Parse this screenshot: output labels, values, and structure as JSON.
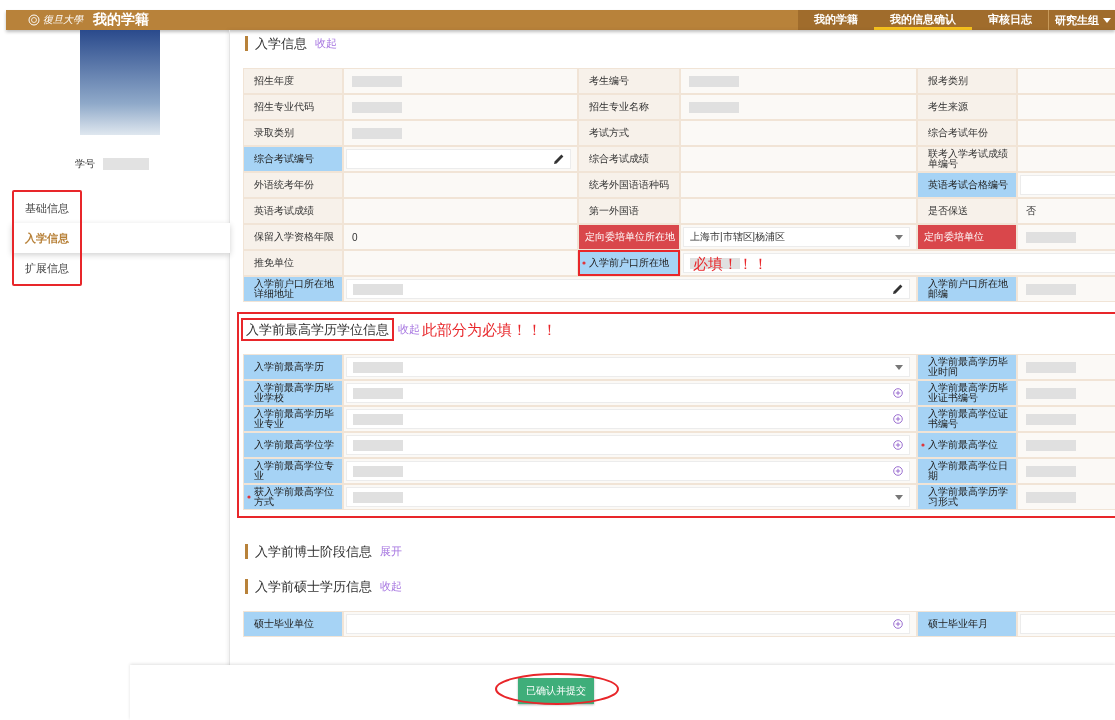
{
  "header": {
    "logo_text": "復旦大學",
    "title": "我的学籍",
    "nav": [
      {
        "label": "我的学籍",
        "selected": false
      },
      {
        "label": "我的信息确认",
        "selected": true
      },
      {
        "label": "审核日志",
        "selected": false
      }
    ],
    "user_menu": "研究生组"
  },
  "sidebar": {
    "student_id_label": "学号",
    "annotated": true,
    "items": [
      {
        "label": "基础信息",
        "selected": false
      },
      {
        "label": "入学信息",
        "selected": true
      },
      {
        "label": "扩展信息",
        "selected": false
      }
    ]
  },
  "sections": [
    {
      "title": "入学信息",
      "toggle": "收起",
      "annotated": false,
      "title_boxed": false,
      "rows": [
        {
          "fields": [
            {
              "label": "招生年度",
              "editable": false,
              "alert": false,
              "required": false,
              "annotated": false,
              "wide": false,
              "kind": "plain",
              "redacted": true
            },
            {
              "label": "考生编号",
              "editable": false,
              "alert": false,
              "required": false,
              "annotated": false,
              "wide": false,
              "kind": "plain",
              "redacted": true
            },
            {
              "label": "报考类别",
              "editable": false,
              "alert": false,
              "required": false,
              "annotated": false,
              "wide": false,
              "kind": "plain",
              "redacted": false
            }
          ]
        },
        {
          "fields": [
            {
              "label": "招生专业代码",
              "editable": false,
              "alert": false,
              "required": false,
              "annotated": false,
              "wide": false,
              "kind": "plain",
              "redacted": true
            },
            {
              "label": "招生专业名称",
              "editable": false,
              "alert": false,
              "required": false,
              "annotated": false,
              "wide": false,
              "kind": "plain",
              "redacted": true
            },
            {
              "label": "考生来源",
              "editable": false,
              "alert": false,
              "required": false,
              "annotated": false,
              "wide": false,
              "kind": "plain",
              "redacted": false
            }
          ]
        },
        {
          "fields": [
            {
              "label": "录取类别",
              "editable": false,
              "alert": false,
              "required": false,
              "annotated": false,
              "wide": false,
              "kind": "plain",
              "redacted": true
            },
            {
              "label": "考试方式",
              "editable": false,
              "alert": false,
              "required": false,
              "annotated": false,
              "wide": false,
              "kind": "plain",
              "redacted": false
            },
            {
              "label": "综合考试年份",
              "editable": false,
              "alert": false,
              "required": false,
              "annotated": false,
              "wide": false,
              "kind": "plain",
              "redacted": false
            }
          ]
        },
        {
          "fields": [
            {
              "label": "综合考试编号",
              "editable": true,
              "alert": false,
              "required": false,
              "annotated": false,
              "wide": false,
              "kind": "edit",
              "redacted": false
            },
            {
              "label": "综合考试成绩",
              "editable": false,
              "alert": false,
              "required": false,
              "annotated": false,
              "wide": false,
              "kind": "plain",
              "redacted": false
            },
            {
              "label": "联考入学考试成绩单编号",
              "editable": false,
              "alert": false,
              "required": false,
              "annotated": false,
              "wide": false,
              "kind": "plain",
              "redacted": false
            }
          ]
        },
        {
          "fields": [
            {
              "label": "外语统考年份",
              "editable": false,
              "alert": false,
              "required": false,
              "annotated": false,
              "wide": false,
              "kind": "plain",
              "redacted": false
            },
            {
              "label": "统考外国语语种码",
              "editable": false,
              "alert": false,
              "required": false,
              "annotated": false,
              "wide": false,
              "kind": "plain",
              "redacted": false
            },
            {
              "label": "英语考试合格编号",
              "editable": true,
              "alert": false,
              "required": false,
              "annotated": false,
              "wide": false,
              "kind": "input",
              "redacted": false
            }
          ]
        },
        {
          "fields": [
            {
              "label": "英语考试成绩",
              "editable": false,
              "alert": false,
              "required": false,
              "annotated": false,
              "wide": false,
              "kind": "plain",
              "redacted": false
            },
            {
              "label": "第一外国语",
              "editable": false,
              "alert": false,
              "required": false,
              "annotated": false,
              "wide": false,
              "kind": "plain",
              "redacted": false
            },
            {
              "label": "是否保送",
              "editable": false,
              "alert": false,
              "required": false,
              "annotated": false,
              "wide": false,
              "kind": "plain",
              "redacted": false,
              "value": "否"
            }
          ]
        },
        {
          "fields": [
            {
              "label": "保留入学资格年限",
              "editable": false,
              "alert": false,
              "required": false,
              "annotated": false,
              "wide": false,
              "kind": "plain",
              "redacted": false,
              "value": "0"
            },
            {
              "label": "定向委培单位所在地",
              "editable": false,
              "alert": true,
              "required": false,
              "annotated": false,
              "wide": false,
              "kind": "select",
              "redacted": false,
              "value": "上海市|市辖区|杨浦区"
            },
            {
              "label": "定向委培单位",
              "editable": false,
              "alert": true,
              "required": false,
              "annotated": false,
              "wide": false,
              "kind": "plain",
              "redacted": true
            }
          ]
        },
        {
          "fields": [
            {
              "label": "推免单位",
              "editable": false,
              "alert": false,
              "required": false,
              "annotated": false,
              "wide": false,
              "kind": "plain",
              "redacted": false
            },
            {
              "label": "入学前户口所在地",
              "editable": true,
              "alert": false,
              "required": true,
              "annotated": true,
              "wide": true,
              "kind": "input",
              "redacted": true,
              "note": "必填！！！"
            }
          ]
        },
        {
          "fields": [
            {
              "label": "入学前户口所在地详细地址",
              "editable": true,
              "alert": false,
              "required": false,
              "annotated": false,
              "wide": true,
              "kind": "edit",
              "redacted": true
            },
            {
              "label": "入学前户口所在地邮编",
              "editable": true,
              "alert": false,
              "required": false,
              "annotated": false,
              "wide": false,
              "kind": "plain",
              "redacted": true
            }
          ]
        }
      ]
    },
    {
      "title": "入学前最高学历学位信息",
      "toggle": "收起",
      "note": "此部分为必填！！！",
      "annotated": true,
      "title_boxed": true,
      "rows": [
        {
          "fields": [
            {
              "label": "入学前最高学历",
              "editable": true,
              "alert": false,
              "required": false,
              "annotated": false,
              "wide": true,
              "kind": "select",
              "redacted": true
            },
            {
              "label": "入学前最高学历毕业时间",
              "editable": true,
              "alert": false,
              "required": false,
              "annotated": false,
              "wide": false,
              "kind": "plain",
              "redacted": true
            }
          ]
        },
        {
          "fields": [
            {
              "label": "入学前最高学历毕业学校",
              "editable": true,
              "alert": false,
              "required": false,
              "annotated": false,
              "wide": true,
              "kind": "upload",
              "redacted": true
            },
            {
              "label": "入学前最高学历毕业证书编号",
              "editable": true,
              "alert": false,
              "required": false,
              "annotated": false,
              "wide": false,
              "kind": "plain",
              "redacted": true
            }
          ]
        },
        {
          "fields": [
            {
              "label": "入学前最高学历毕业专业",
              "editable": true,
              "alert": false,
              "required": false,
              "annotated": false,
              "wide": true,
              "kind": "upload",
              "redacted": true
            },
            {
              "label": "入学前最高学位证书编号",
              "editable": true,
              "alert": false,
              "required": false,
              "annotated": false,
              "wide": false,
              "kind": "plain",
              "redacted": true
            }
          ]
        },
        {
          "fields": [
            {
              "label": "入学前最高学位学",
              "editable": true,
              "alert": false,
              "required": false,
              "annotated": false,
              "wide": true,
              "kind": "upload",
              "redacted": true
            },
            {
              "label": "入学前最高学位",
              "editable": true,
              "alert": false,
              "required": true,
              "annotated": false,
              "wide": false,
              "kind": "plain",
              "redacted": true
            }
          ]
        },
        {
          "fields": [
            {
              "label": "入学前最高学位专业",
              "editable": true,
              "alert": false,
              "required": false,
              "annotated": false,
              "wide": true,
              "kind": "upload",
              "redacted": true
            },
            {
              "label": "入学前最高学位日期",
              "editable": true,
              "alert": false,
              "required": false,
              "annotated": false,
              "wide": false,
              "kind": "plain",
              "redacted": true
            }
          ]
        },
        {
          "fields": [
            {
              "label": "获入学前最高学位方式",
              "editable": true,
              "alert": false,
              "required": true,
              "annotated": false,
              "wide": true,
              "kind": "select",
              "redacted": true
            },
            {
              "label": "入学前最高学历学习形式",
              "editable": true,
              "alert": false,
              "required": false,
              "annotated": false,
              "wide": false,
              "kind": "plain",
              "redacted": true
            }
          ]
        }
      ]
    },
    {
      "title": "入学前博士阶段信息",
      "toggle": "展开",
      "annotated": false,
      "title_boxed": false
    },
    {
      "title": "入学前硕士学历信息",
      "toggle": "收起",
      "annotated": false,
      "title_boxed": false,
      "rows": [
        {
          "fields": [
            {
              "label": "硕士毕业单位",
              "editable": true,
              "alert": false,
              "required": false,
              "annotated": false,
              "wide": true,
              "kind": "upload",
              "redacted": false
            },
            {
              "label": "硕士毕业年月",
              "editable": true,
              "alert": false,
              "required": false,
              "annotated": false,
              "wide": false,
              "kind": "input",
              "redacted": false
            }
          ]
        }
      ]
    }
  ],
  "footer": {
    "button": "已确认并提交",
    "annotated": true
  }
}
